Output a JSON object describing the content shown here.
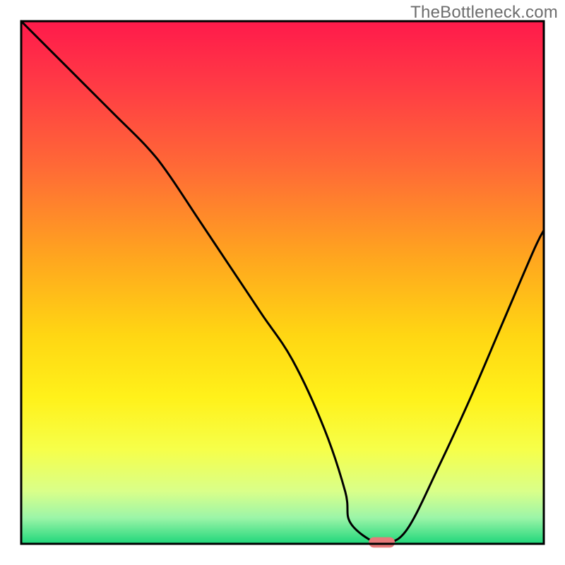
{
  "watermark_text": "TheBottleneck.com",
  "chart_data": {
    "type": "line",
    "title": "",
    "xlabel": "",
    "ylabel": "",
    "x_range": [
      0,
      100
    ],
    "y_range": [
      0,
      100
    ],
    "series": [
      {
        "name": "curve",
        "x": [
          0,
          6,
          12,
          18,
          24,
          28,
          34,
          40,
          46,
          52,
          58,
          62,
          63,
          68,
          70,
          74,
          80,
          86,
          92,
          98,
          100
        ],
        "y": [
          100,
          94,
          88,
          82,
          76,
          71,
          62,
          53,
          44,
          35,
          22,
          10,
          4,
          0,
          0,
          3,
          15,
          28,
          42,
          56,
          60
        ]
      }
    ],
    "marker": {
      "x": 69,
      "y": 0,
      "rx": 2.5,
      "ry": 1.0,
      "color": "#e77a7a"
    },
    "gradient_stops": [
      {
        "offset": 0.0,
        "color": "#ff1a4b"
      },
      {
        "offset": 0.12,
        "color": "#ff3a45"
      },
      {
        "offset": 0.28,
        "color": "#ff6a36"
      },
      {
        "offset": 0.45,
        "color": "#ffa51f"
      },
      {
        "offset": 0.6,
        "color": "#ffd613"
      },
      {
        "offset": 0.72,
        "color": "#fff11a"
      },
      {
        "offset": 0.82,
        "color": "#f6ff4a"
      },
      {
        "offset": 0.9,
        "color": "#d9ff8a"
      },
      {
        "offset": 0.95,
        "color": "#9cf5a8"
      },
      {
        "offset": 1.0,
        "color": "#1fd67a"
      }
    ],
    "frame": {
      "stroke": "#000000",
      "width": 3
    }
  }
}
